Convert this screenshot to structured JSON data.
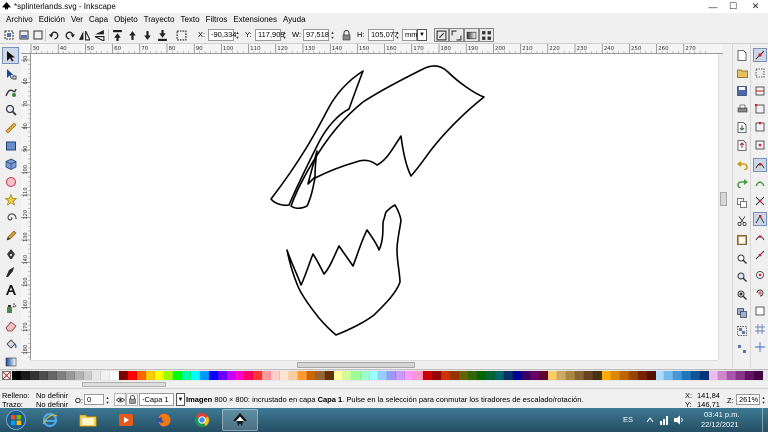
{
  "window": {
    "title": "*splinterlands.svg - Inkscape",
    "controls": {
      "minimize": "—",
      "maximize": "☐",
      "close": "✕"
    }
  },
  "menu": [
    "Archivo",
    "Edición",
    "Ver",
    "Capa",
    "Objeto",
    "Trayecto",
    "Texto",
    "Filtros",
    "Extensiones",
    "Ayuda"
  ],
  "tool_controls": {
    "x_label": "X:",
    "x_value": "-90,334",
    "y_label": "Y:",
    "y_value": "117,909",
    "w_label": "W:",
    "w_value": "97,518",
    "h_label": "H:",
    "h_value": "105,077",
    "unit": "mm"
  },
  "ruler": {
    "top_ticks": [
      "30",
      "40",
      "50",
      "60",
      "70",
      "80",
      "90",
      "100",
      "110",
      "120",
      "130",
      "140",
      "150",
      "160",
      "170",
      "180",
      "190",
      "200",
      "210",
      "220",
      "230",
      "240",
      "250",
      "260",
      "270"
    ],
    "left_ticks": [
      "50",
      "60",
      "70",
      "80",
      "90",
      "100",
      "110",
      "120",
      "130",
      "140",
      "150",
      "160",
      "170",
      "180"
    ]
  },
  "palette": {
    "colors": [
      "#000000",
      "#1a1a1a",
      "#333333",
      "#4d4d4d",
      "#666666",
      "#808080",
      "#999999",
      "#b3b3b3",
      "#cccccc",
      "#e6e6e6",
      "#f2f2f2",
      "#ffffff",
      "#800000",
      "#ff0000",
      "#ff6600",
      "#ffcc00",
      "#ffff00",
      "#99ff00",
      "#00ff00",
      "#00ff99",
      "#00ffff",
      "#0099ff",
      "#0000ff",
      "#6600ff",
      "#cc00ff",
      "#ff00cc",
      "#ff0066",
      "#ff3333",
      "#ff9999",
      "#ffcccc",
      "#ffe5cc",
      "#ffcc99",
      "#ff9933",
      "#cc6600",
      "#996633",
      "#663300",
      "#ffff99",
      "#ccff99",
      "#99ff99",
      "#99ffcc",
      "#99ffff",
      "#99ccff",
      "#9999ff",
      "#cc99ff",
      "#ff99ff",
      "#ff99cc",
      "#cc0000",
      "#990000",
      "#cc3300",
      "#993300",
      "#666600",
      "#336600",
      "#006600",
      "#006633",
      "#006666",
      "#003366",
      "#000099",
      "#330066",
      "#660066",
      "#660033",
      "#ffcc66",
      "#ccaa66",
      "#aa8844",
      "#886633",
      "#664422",
      "#443311",
      "#ffaa00",
      "#dd8800",
      "#bb6600",
      "#994400",
      "#772200",
      "#551100",
      "#aaddff",
      "#77bbee",
      "#4499dd",
      "#2277bb",
      "#115599",
      "#003377",
      "#eebbee",
      "#cc88cc",
      "#aa55aa",
      "#883388",
      "#661166",
      "#440044"
    ]
  },
  "status": {
    "fill_label": "Relleno:",
    "fill_value": "No definir",
    "stroke_label": "Trazo:",
    "stroke_value": "No definir",
    "opacity_label": "O:",
    "opacity_value": "0",
    "layer": "-Capa 1",
    "message_bold1": "Imagen",
    "message_part1": " 800 × 800: incrustado en capa ",
    "message_bold2": "Capa 1",
    "message_part2": ". Pulse en la selección para conmutar los tiradores de escalado/rotación.",
    "cursor_x_label": "X:",
    "cursor_x": "141,84",
    "cursor_y_label": "Y:",
    "cursor_y": "146,71",
    "zoom_label": "Z:",
    "zoom": "261%"
  },
  "taskbar": {
    "language": "ES",
    "time": "03:41 p.m.",
    "date": "22/12/2021"
  }
}
